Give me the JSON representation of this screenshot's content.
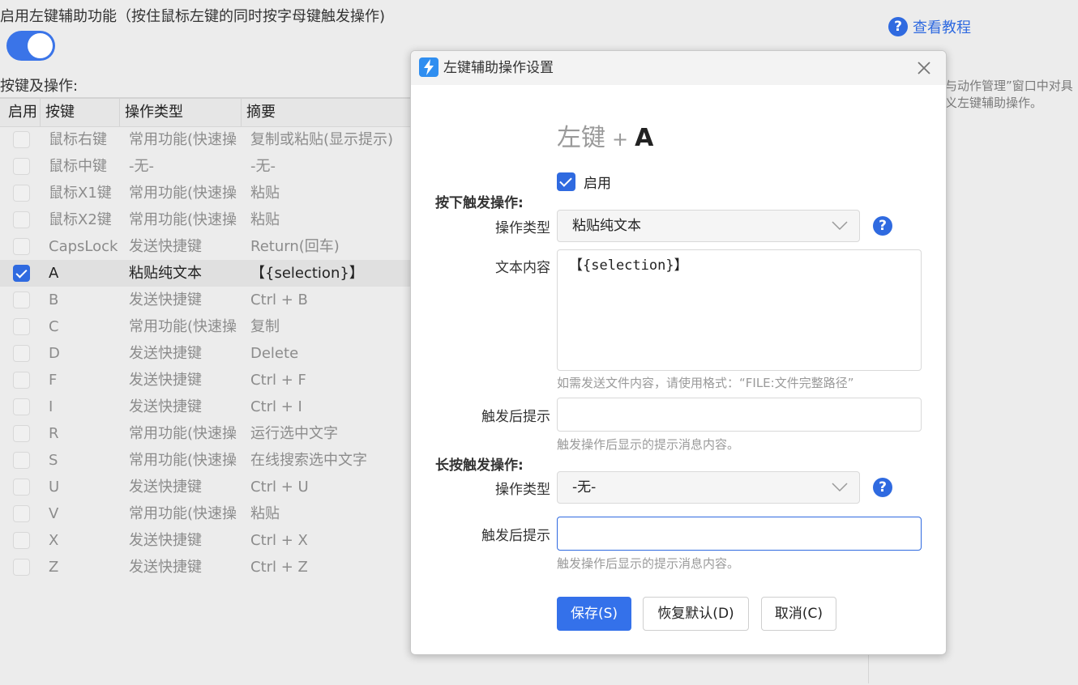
{
  "background": {
    "title": "启用左键辅助功能（按住鼠标左键的同时按字母键触发操作)",
    "keys_label": "按键及操作:",
    "help_link": "查看教程",
    "side_note_line1": "与动作管理”窗口中对具",
    "side_note_line2": "义左键辅助操作。",
    "table": {
      "headers": [
        "启用",
        "按键",
        "操作类型",
        "摘要"
      ],
      "rows": [
        {
          "enabled": false,
          "key": "鼠标右键",
          "type": "常用功能(快速操",
          "summary": "复制或粘贴(显示提示)"
        },
        {
          "enabled": false,
          "key": "鼠标中键",
          "type": "-无-",
          "summary": "-无-"
        },
        {
          "enabled": false,
          "key": "鼠标X1键",
          "type": "常用功能(快速操",
          "summary": "粘贴"
        },
        {
          "enabled": false,
          "key": "鼠标X2键",
          "type": "常用功能(快速操",
          "summary": "粘贴"
        },
        {
          "enabled": false,
          "key": "CapsLock",
          "type": "发送快捷键",
          "summary": "Return(回车)"
        },
        {
          "enabled": true,
          "key": "A",
          "type": "粘贴纯文本",
          "summary": "【{selection}】",
          "selected": true
        },
        {
          "enabled": false,
          "key": "B",
          "type": "发送快捷键",
          "summary": "Ctrl + B"
        },
        {
          "enabled": false,
          "key": "C",
          "type": "常用功能(快速操",
          "summary": "复制"
        },
        {
          "enabled": false,
          "key": "D",
          "type": "发送快捷键",
          "summary": "Delete"
        },
        {
          "enabled": false,
          "key": "F",
          "type": "发送快捷键",
          "summary": "Ctrl + F"
        },
        {
          "enabled": false,
          "key": "I",
          "type": "发送快捷键",
          "summary": "Ctrl + I"
        },
        {
          "enabled": false,
          "key": "R",
          "type": "常用功能(快速操",
          "summary": "运行选中文字"
        },
        {
          "enabled": false,
          "key": "S",
          "type": "常用功能(快速操",
          "summary": "在线搜索选中文字"
        },
        {
          "enabled": false,
          "key": "U",
          "type": "发送快捷键",
          "summary": "Ctrl + U"
        },
        {
          "enabled": false,
          "key": "V",
          "type": "常用功能(快速操",
          "summary": "粘贴"
        },
        {
          "enabled": false,
          "key": "X",
          "type": "发送快捷键",
          "summary": "Ctrl + X"
        },
        {
          "enabled": false,
          "key": "Z",
          "type": "发送快捷键",
          "summary": "Ctrl + Z"
        }
      ]
    }
  },
  "dialog": {
    "title": "左键辅助操作设置",
    "app_icon": "lightning-icon",
    "combo": {
      "modifier": "左键",
      "plus": "+",
      "key": "A"
    },
    "enable_label": "启用",
    "press_section": "按下触发操作:",
    "op_type_label": "操作类型",
    "press_op_type": "粘贴纯文本",
    "text_content_label": "文本内容",
    "text_content": "【{selection}】",
    "text_hint": "如需发送文件内容，请使用格式：“FILE:文件完整路径”",
    "after_tip_label": "触发后提示",
    "after_tip_value": "",
    "after_tip_hint": "触发操作后显示的提示消息内容。",
    "long_section": "长按触发操作:",
    "long_op_type": "-无-",
    "long_after_tip_value": "",
    "buttons": {
      "save": "保存(S)",
      "reset": "恢复默认(D)",
      "cancel": "取消(C)"
    },
    "accent_color": "#3471ea"
  }
}
